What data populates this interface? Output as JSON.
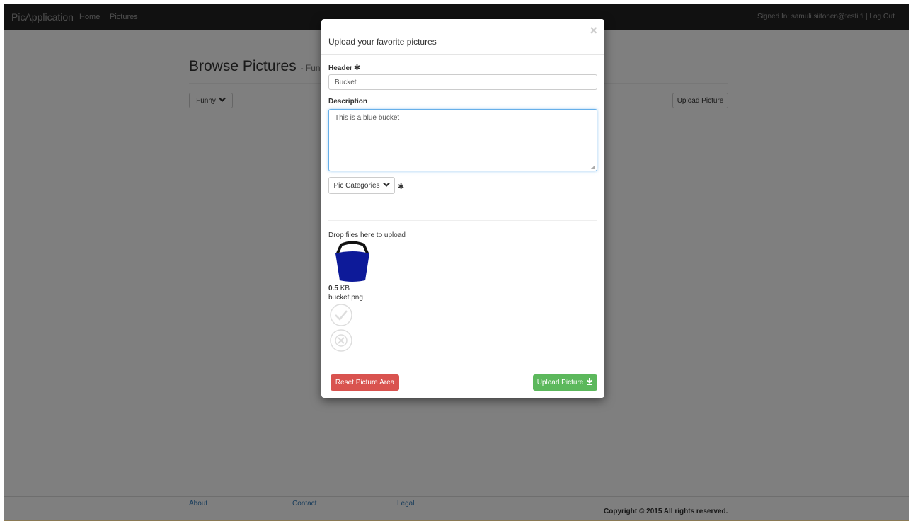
{
  "navbar": {
    "brand": "PicApplication",
    "links": [
      "Home",
      "Pictures"
    ],
    "signed_in": "Signed In: samuli.siitonen@testi.fi | Log Out"
  },
  "page": {
    "title": "Browse Pictures",
    "subtitle": "- Funny",
    "filter_label": "Funny",
    "upload_label": "Upload Picture"
  },
  "footer": {
    "links": [
      "About",
      "Contact",
      "Legal"
    ],
    "copyright": "Copyright © 2015 All rights reserved."
  },
  "modal": {
    "title": "Upload your favorite pictures",
    "close": "×",
    "header_label": "Header",
    "required_mark": "✱",
    "header_value": "Bucket",
    "description_label": "Description",
    "description_value": "This is a blue bucket",
    "categories_label": "Pic Categories",
    "dropzone_text": "Drop files here to upload",
    "file": {
      "size_value": "0.5",
      "size_unit": "KB",
      "name": "bucket.png"
    },
    "reset_label": "Reset Picture Area",
    "upload_label": "Upload Picture"
  },
  "colors": {
    "navbar": "#222222",
    "danger": "#d9534f",
    "success": "#5cb85c",
    "bucket": "#0d1a99",
    "link": "#337ab7"
  }
}
